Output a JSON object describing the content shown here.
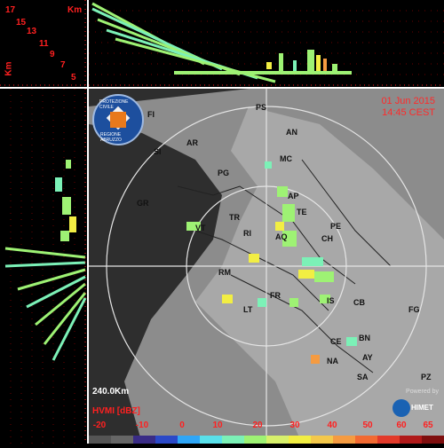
{
  "top_left": {
    "km_label": "Km",
    "km_axis_label": "Km",
    "km_values": [
      "17",
      "15",
      "13",
      "11",
      "9",
      "7",
      "5"
    ]
  },
  "map": {
    "date": "01 Jun 2015",
    "time": "14:45 CEST",
    "range_label": "240.0Km",
    "scale_title": "HVMI [dBZ]",
    "scale_ticks": [
      "-20",
      "-10",
      "0",
      "10",
      "20",
      "30",
      "40",
      "50",
      "60",
      "65"
    ],
    "scale_colors": [
      "#555555",
      "#666666",
      "#3a2c86",
      "#2b49c8",
      "#2fa6f7",
      "#59e0ea",
      "#7cf1b7",
      "#9ef274",
      "#d7f06b",
      "#f2ee43",
      "#f4c84b",
      "#f59b41",
      "#f26a32",
      "#e23a2a",
      "#b01a1a",
      "#7f0f0f"
    ],
    "cities": [
      "PS",
      "FI",
      "AN",
      "AR",
      "SI",
      "MC",
      "PG",
      "GR",
      "AP",
      "TE",
      "TR",
      "PE",
      "VT",
      "RI",
      "AQ",
      "CH",
      "RM",
      "IS",
      "FR",
      "CB",
      "LT",
      "FG",
      "CE",
      "BN",
      "AY",
      "NA",
      "SA",
      "PZ"
    ],
    "logo_text": "PROTEZIONE CIVILE",
    "logo_subtext": "REGIONE ABRUZZO",
    "powered_by": "Powered by",
    "himet": "HIMET"
  }
}
